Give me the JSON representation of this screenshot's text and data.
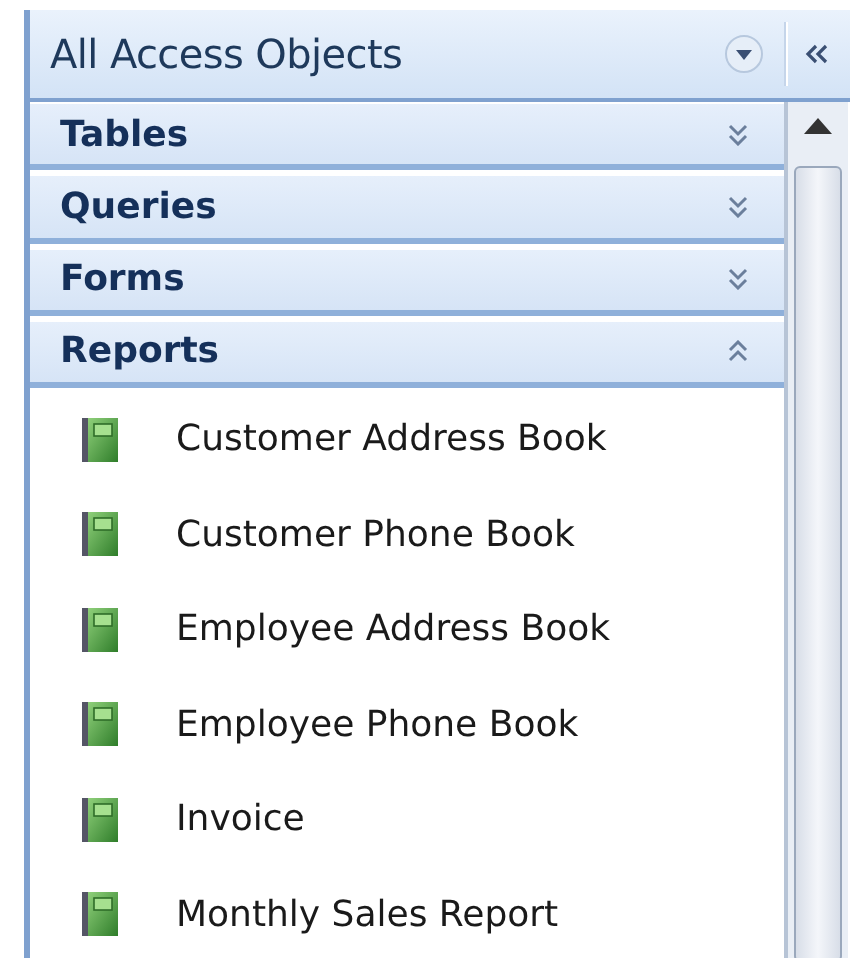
{
  "pane": {
    "title": "All Access Objects"
  },
  "groups": [
    {
      "label": "Tables",
      "expanded": false
    },
    {
      "label": "Queries",
      "expanded": false
    },
    {
      "label": "Forms",
      "expanded": false
    },
    {
      "label": "Reports",
      "expanded": true,
      "items": [
        "Customer Address Book",
        "Customer Phone Book",
        "Employee Address Book",
        "Employee Phone Book",
        "Invoice",
        "Monthly Sales Report"
      ]
    }
  ]
}
